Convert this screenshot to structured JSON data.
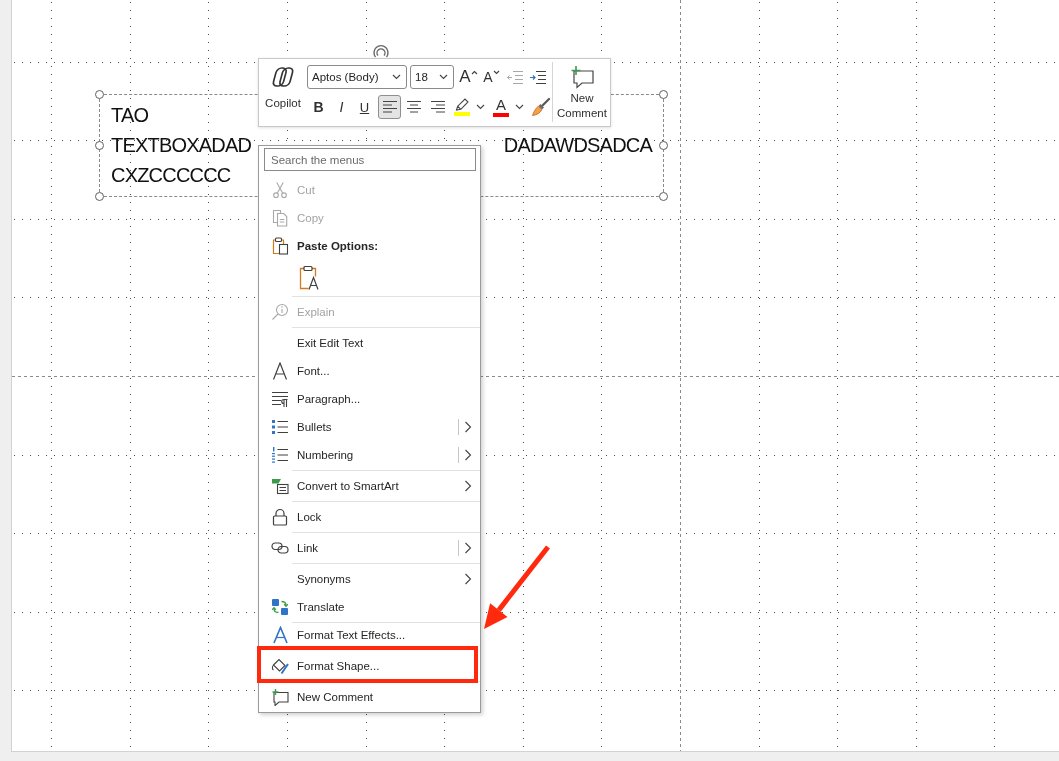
{
  "text_box": {
    "selected": true,
    "lines": [
      [
        "TAO"
      ],
      [
        "TEXTBOXADAD",
        "DADAWDSADCA"
      ],
      [
        "CXZCCCCCC"
      ]
    ]
  },
  "mini_toolbar": {
    "copilot": {
      "label": "Copilot"
    },
    "font_name": {
      "value": "Aptos (Body)"
    },
    "font_size": {
      "value": "18"
    },
    "row_1_buttons": [
      {
        "kind": "grow",
        "label": "A",
        "disabled": false
      },
      {
        "kind": "shrink",
        "label": "A",
        "disabled": false
      },
      {
        "kind": "outdent",
        "disabled": true
      },
      {
        "kind": "indent",
        "disabled": false
      }
    ],
    "row_2_buttons": [
      {
        "kind": "bold",
        "label": "B",
        "selected": false
      },
      {
        "kind": "italic",
        "label": "I",
        "selected": false
      },
      {
        "kind": "underline",
        "label": "U",
        "selected": false
      },
      {
        "kind": "left",
        "selected": true
      },
      {
        "kind": "center",
        "selected": false
      },
      {
        "kind": "right",
        "selected": false
      },
      {
        "kind": "highlight",
        "color": "#ffff00"
      },
      {
        "kind": "fontcolor",
        "label": "A",
        "color": "#ff0000"
      },
      {
        "kind": "painter"
      }
    ],
    "new_comment": {
      "label": "New Comment"
    }
  },
  "context_menu": {
    "search": {
      "placeholder": "Search the menus"
    },
    "items": [
      {
        "kind": "command",
        "label": "Cut",
        "disabled": true,
        "divider_above": false,
        "submenu": false,
        "split": false,
        "annotated": false
      },
      {
        "kind": "command",
        "label": "Copy",
        "disabled": true,
        "divider_above": false,
        "submenu": false,
        "split": false,
        "annotated": false
      },
      {
        "kind": "header",
        "label": "Paste Options:",
        "disabled": false,
        "divider_above": false,
        "submenu": false,
        "split": false,
        "annotated": false
      },
      {
        "kind": "paste",
        "disabled": false,
        "divider_above": false,
        "submenu": false,
        "split": false,
        "annotated": false
      },
      {
        "kind": "command",
        "label": "Explain",
        "disabled": true,
        "divider_above": true,
        "submenu": false,
        "split": false,
        "annotated": false
      },
      {
        "kind": "command",
        "label": "Exit Edit Text",
        "disabled": false,
        "divider_above": true,
        "submenu": false,
        "split": false,
        "annotated": false
      },
      {
        "kind": "command",
        "label": "Font...",
        "disabled": false,
        "divider_above": false,
        "submenu": false,
        "split": false,
        "annotated": false
      },
      {
        "kind": "command",
        "label": "Paragraph...",
        "disabled": false,
        "divider_above": false,
        "submenu": false,
        "split": false,
        "annotated": false
      },
      {
        "kind": "command",
        "label": "Bullets",
        "disabled": false,
        "divider_above": false,
        "submenu": true,
        "split": true,
        "annotated": false
      },
      {
        "kind": "command",
        "label": "Numbering",
        "disabled": false,
        "divider_above": false,
        "submenu": true,
        "split": true,
        "annotated": false
      },
      {
        "kind": "command",
        "label": "Convert to SmartArt",
        "disabled": false,
        "divider_above": true,
        "submenu": true,
        "split": false,
        "annotated": false
      },
      {
        "kind": "command",
        "label": "Lock",
        "disabled": false,
        "divider_above": true,
        "submenu": false,
        "split": false,
        "annotated": false
      },
      {
        "kind": "command",
        "label": "Link",
        "disabled": false,
        "divider_above": true,
        "submenu": true,
        "split": true,
        "annotated": false
      },
      {
        "kind": "command",
        "label": "Synonyms",
        "disabled": false,
        "divider_above": true,
        "submenu": true,
        "split": false,
        "annotated": false
      },
      {
        "kind": "command",
        "label": "Translate",
        "disabled": false,
        "divider_above": false,
        "submenu": false,
        "split": false,
        "annotated": false
      },
      {
        "kind": "command",
        "label": "Format Text Effects...",
        "disabled": false,
        "divider_above": true,
        "submenu": false,
        "split": false,
        "annotated": false
      },
      {
        "kind": "command",
        "label": "Format Shape...",
        "disabled": false,
        "divider_above": false,
        "submenu": false,
        "split": false,
        "annotated": true
      },
      {
        "kind": "command",
        "label": "New Comment",
        "disabled": false,
        "divider_above": true,
        "submenu": false,
        "split": false,
        "annotated": false
      }
    ]
  }
}
